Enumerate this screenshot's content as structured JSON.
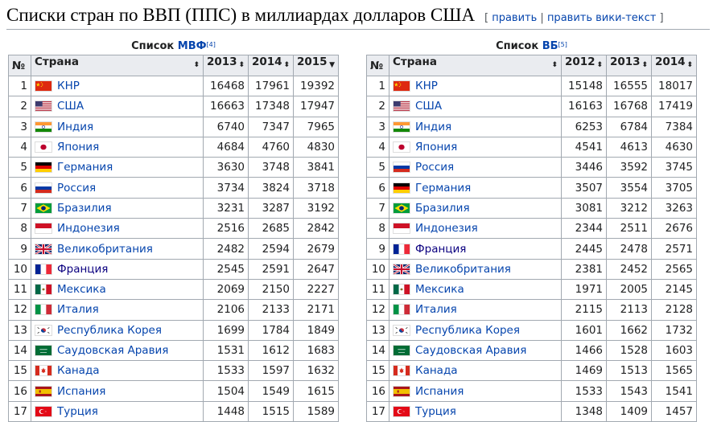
{
  "heading": {
    "title": "Списки стран по ВВП (ППС) в миллиардах долларов США",
    "edit_open": "[ ",
    "edit_link": "править",
    "edit_sep": " | ",
    "edit_source_link": "править вики-текст",
    "edit_close": " ]"
  },
  "tables": [
    {
      "caption_prefix": "Список ",
      "caption_link": "МВФ",
      "caption_ref": "[4]",
      "headers": [
        "№",
        "Страна",
        "2013",
        "2014",
        "2015"
      ],
      "rows": [
        {
          "n": "1",
          "country": "КНР",
          "flag": "china",
          "v": [
            "16468",
            "17961",
            "19392"
          ]
        },
        {
          "n": "2",
          "country": "США",
          "flag": "usa",
          "v": [
            "16663",
            "17348",
            "17947"
          ]
        },
        {
          "n": "3",
          "country": "Индия",
          "flag": "india",
          "v": [
            "6740",
            "7347",
            "7965"
          ]
        },
        {
          "n": "4",
          "country": "Япония",
          "flag": "japan",
          "v": [
            "4684",
            "4760",
            "4830"
          ]
        },
        {
          "n": "5",
          "country": "Германия",
          "flag": "germany",
          "v": [
            "3630",
            "3748",
            "3841"
          ]
        },
        {
          "n": "6",
          "country": "Россия",
          "flag": "russia",
          "v": [
            "3734",
            "3824",
            "3718"
          ]
        },
        {
          "n": "7",
          "country": "Бразилия",
          "flag": "brazil",
          "v": [
            "3231",
            "3287",
            "3192"
          ]
        },
        {
          "n": "8",
          "country": "Индонезия",
          "flag": "indonesia",
          "v": [
            "2516",
            "2685",
            "2842"
          ]
        },
        {
          "n": "9",
          "country": "Великобритания",
          "flag": "uk",
          "v": [
            "2482",
            "2594",
            "2679"
          ]
        },
        {
          "n": "10",
          "country": "Франция",
          "flag": "france",
          "v": [
            "2545",
            "2591",
            "2647"
          ]
        },
        {
          "n": "11",
          "country": "Мексика",
          "flag": "mexico",
          "v": [
            "2069",
            "2150",
            "2227"
          ]
        },
        {
          "n": "12",
          "country": "Италия",
          "flag": "italy",
          "v": [
            "2106",
            "2133",
            "2171"
          ]
        },
        {
          "n": "13",
          "country": "Республика Корея",
          "flag": "korea",
          "v": [
            "1699",
            "1784",
            "1849"
          ]
        },
        {
          "n": "14",
          "country": "Саудовская Аравия",
          "flag": "saudi",
          "v": [
            "1531",
            "1612",
            "1683"
          ]
        },
        {
          "n": "15",
          "country": "Канада",
          "flag": "canada",
          "v": [
            "1533",
            "1597",
            "1632"
          ]
        },
        {
          "n": "16",
          "country": "Испания",
          "flag": "spain",
          "v": [
            "1504",
            "1549",
            "1615"
          ]
        },
        {
          "n": "17",
          "country": "Турция",
          "flag": "turkey",
          "v": [
            "1448",
            "1515",
            "1589"
          ]
        }
      ]
    },
    {
      "caption_prefix": "Список ",
      "caption_link": "ВБ",
      "caption_ref": "[5]",
      "headers": [
        "№",
        "Страна",
        "2012",
        "2013",
        "2014"
      ],
      "rows": [
        {
          "n": "1",
          "country": "КНР",
          "flag": "china",
          "v": [
            "15148",
            "16555",
            "18017"
          ]
        },
        {
          "n": "2",
          "country": "США",
          "flag": "usa",
          "v": [
            "16163",
            "16768",
            "17419"
          ]
        },
        {
          "n": "3",
          "country": "Индия",
          "flag": "india",
          "v": [
            "6253",
            "6784",
            "7384"
          ]
        },
        {
          "n": "4",
          "country": "Япония",
          "flag": "japan",
          "v": [
            "4541",
            "4613",
            "4630"
          ]
        },
        {
          "n": "5",
          "country": "Россия",
          "flag": "russia",
          "v": [
            "3446",
            "3592",
            "3745"
          ]
        },
        {
          "n": "6",
          "country": "Германия",
          "flag": "germany",
          "v": [
            "3507",
            "3554",
            "3705"
          ]
        },
        {
          "n": "7",
          "country": "Бразилия",
          "flag": "brazil",
          "v": [
            "3081",
            "3212",
            "3263"
          ]
        },
        {
          "n": "8",
          "country": "Индонезия",
          "flag": "indonesia",
          "v": [
            "2344",
            "2511",
            "2676"
          ]
        },
        {
          "n": "9",
          "country": "Франция",
          "flag": "france",
          "v": [
            "2445",
            "2478",
            "2571"
          ]
        },
        {
          "n": "10",
          "country": "Великобритания",
          "flag": "uk",
          "v": [
            "2381",
            "2452",
            "2565"
          ]
        },
        {
          "n": "11",
          "country": "Мексика",
          "flag": "mexico",
          "v": [
            "1971",
            "2005",
            "2145"
          ]
        },
        {
          "n": "12",
          "country": "Италия",
          "flag": "italy",
          "v": [
            "2115",
            "2113",
            "2128"
          ]
        },
        {
          "n": "13",
          "country": "Республика Корея",
          "flag": "korea",
          "v": [
            "1601",
            "1662",
            "1732"
          ]
        },
        {
          "n": "14",
          "country": "Саудовская Аравия",
          "flag": "saudi",
          "v": [
            "1466",
            "1528",
            "1603"
          ]
        },
        {
          "n": "15",
          "country": "Канада",
          "flag": "canada",
          "v": [
            "1469",
            "1513",
            "1565"
          ]
        },
        {
          "n": "16",
          "country": "Испания",
          "flag": "spain",
          "v": [
            "1533",
            "1543",
            "1541"
          ]
        },
        {
          "n": "17",
          "country": "Турция",
          "flag": "turkey",
          "v": [
            "1348",
            "1409",
            "1457"
          ]
        }
      ]
    }
  ]
}
